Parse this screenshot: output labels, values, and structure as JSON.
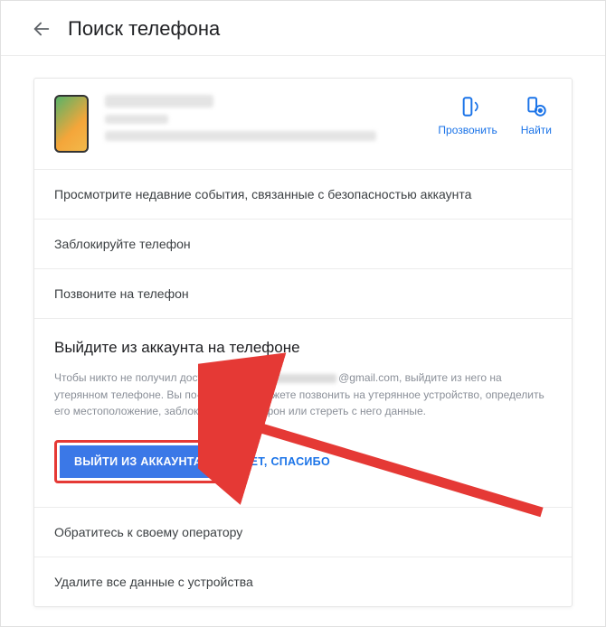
{
  "header": {
    "title": "Поиск телефона"
  },
  "device": {
    "ring_label": "Прозвонить",
    "find_label": "Найти"
  },
  "rows": {
    "security_events": "Просмотрите недавние события, связанные с безопасностью аккаунта",
    "lock_phone": "Заблокируйте телефон",
    "call_phone": "Позвоните на телефон",
    "contact_carrier": "Обратитесь к своему оператору",
    "erase_all": "Удалите все данные с устройства"
  },
  "signout": {
    "title": "Выйдите из аккаунта на телефоне",
    "body_before_email": "Чтобы никто не получил доступ к аккаунту ",
    "body_after_email": "@gmail.com, выйдите из него на утерянном телефоне. Вы по-прежнему сможете позвонить на утерянное устройство, определить его местоположение, заблокировать телефон или стереть с него данные.",
    "primary_btn": "ВЫЙТИ ИЗ АККАУНТА",
    "secondary_btn": "НЕТ, СПАСИБО"
  },
  "colors": {
    "accent": "#1a73e8",
    "primary_btn": "#3b78e7",
    "highlight": "#e53935"
  }
}
